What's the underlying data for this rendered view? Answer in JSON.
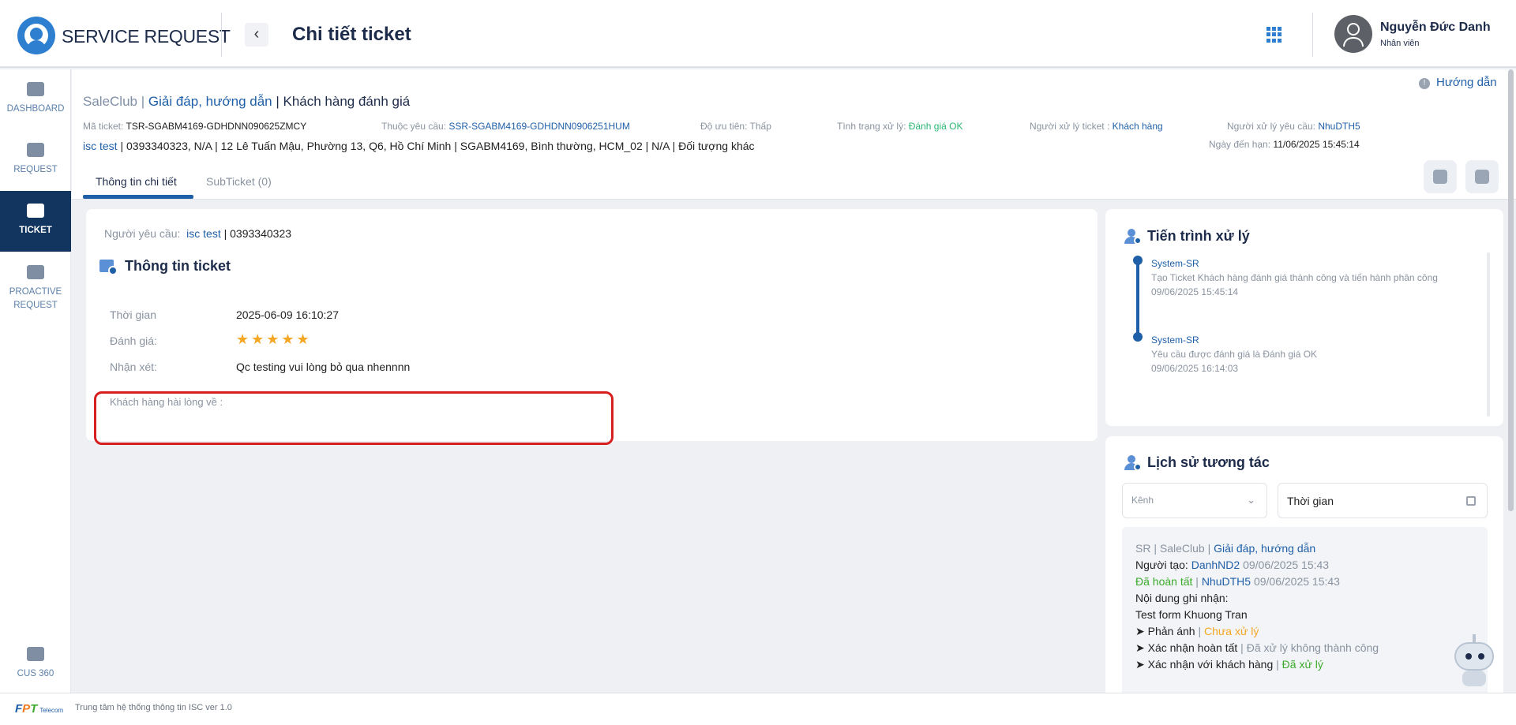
{
  "header": {
    "brand": "SERVICE REQUEST",
    "back_icon": "‹",
    "title": "Chi tiết ticket",
    "user_name": "Nguyễn Đức Danh",
    "user_role": "Nhân viên"
  },
  "sidebar": {
    "items": [
      {
        "label": "DASHBOARD",
        "icon": "home-icon"
      },
      {
        "label": "REQUEST",
        "icon": "edit-icon"
      },
      {
        "label": "TICKET",
        "icon": "server-icon",
        "active": true
      },
      {
        "label": "PROACTIVE REQUEST",
        "icon": "edit-icon"
      },
      {
        "label": "CUS 360",
        "icon": "id-card-icon"
      }
    ]
  },
  "subheader": {
    "help": "Hướng dẫn",
    "crumb1": "SaleClub |",
    "crumb2": "Giải đáp, hướng dẫn",
    "crumb3": "| Khách hàng đánh giá",
    "meta": {
      "ma_ticket_k": "Mã ticket:",
      "ma_ticket_v": "TSR-SGABM4169-GDHDNN090625ZMCY",
      "thuoc_yc_k": "Thuộc yêu cầu:",
      "thuoc_yc_v": "SSR-SGABM4169-GDHDNN0906251HUM",
      "uu_tien_k": "Độ ưu tiên:",
      "uu_tien_v": "Thấp",
      "tinh_trang_k": "Tình trạng xử lý:",
      "tinh_trang_v": "Đánh giá OK",
      "nguoi_xl_ticket_k": "Người xử lý ticket :",
      "nguoi_xl_ticket_v": "Khách hàng",
      "nguoi_xl_yc_k": "Người xử lý yêu cầu:",
      "nguoi_xl_yc_v": "NhuDTH5",
      "ngay_den_han_k": "Ngày đến hạn:",
      "ngay_den_han_v": "11/06/2025 15:45:14"
    },
    "addr_link": "isc test",
    "addr_text": " | 0393340323, N/A | 12 Lê Tuấn Mậu, Phường 13, Q6, Hồ Chí Minh | SGABM4169, Bình thường, HCM_02 | N/A | Đối tượng khác",
    "tabs": [
      "Thông tin chi tiết",
      "SubTicket (0)"
    ]
  },
  "ticket_info": {
    "requester_k": "Người yêu cầu:",
    "requester_link": "isc test",
    "requester_phone": " | 0393340323",
    "title": "Thông tin ticket",
    "time_k": "Thời gian",
    "time_v": "2025-06-09 16:10:27",
    "rating_k": "Đánh giá:",
    "rating_value": 5,
    "stars": "★★★★★",
    "comment_k": "Nhận xét:",
    "comment_v": "Qc testing vui lòng bỏ qua nhennnn",
    "satisfied_k": "Khách hàng hài lòng về :"
  },
  "progress": {
    "title": "Tiến trình xử lý",
    "steps": [
      {
        "who": "System-SR",
        "desc": "Tạo Ticket Khách hàng đánh giá thành công và tiến hành phân công",
        "time": "09/06/2025 15:45:14"
      },
      {
        "who": "System-SR",
        "desc": "Yêu cầu được đánh giá là Đánh giá OK",
        "time": "09/06/2025 16:14:03"
      }
    ]
  },
  "history": {
    "title": "Lịch sử tương tác",
    "channel_placeholder": "Kênh",
    "time_placeholder": "Thời gian",
    "entry": {
      "l1_a": "SR | SaleClub |",
      "l1_b": "Giải đáp, hướng dẫn",
      "l2_k": "Người tạo:",
      "l2_user": "DanhND2",
      "l2_time": "09/06/2025 15:43",
      "l3_status": "Đã hoàn tất",
      "l3_sep": "|",
      "l3_user": "NhuDTH5",
      "l3_time": "09/06/2025 15:43",
      "l4": "Nội dung ghi nhận:",
      "l5": "Test form Khuong Tran",
      "l6_k": "➤ Phản ánh",
      "l6_v": "Chưa xử lý",
      "l7_k": "➤ Xác nhận hoàn tất",
      "l7_v": "Đã xử lý không thành công",
      "l8_k": "➤ Xác nhận với khách hàng",
      "l8_v": "Đã xử lý"
    }
  },
  "footer": {
    "logo_f": "F",
    "logo_p": "P",
    "logo_t": "T",
    "logo_sub": "Telecom",
    "text": "Trung tâm hệ thống thông tin ISC   ver 1.0"
  }
}
